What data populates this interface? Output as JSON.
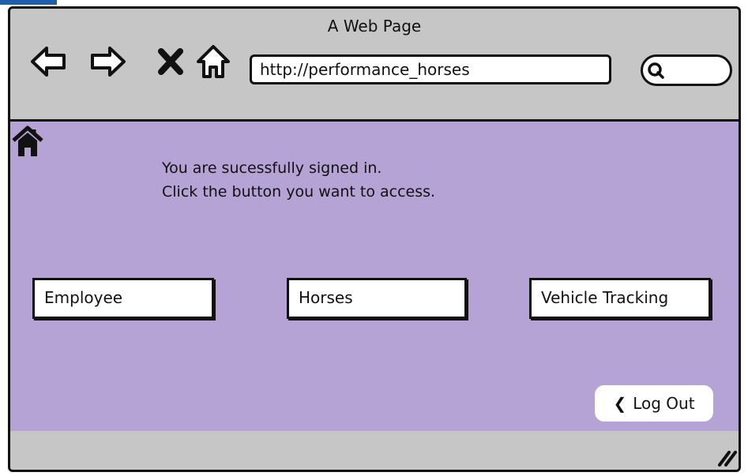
{
  "window": {
    "title": "A Web Page"
  },
  "toolbar": {
    "back_icon": "back-arrow-icon",
    "forward_icon": "forward-arrow-icon",
    "stop_icon": "close-x-icon",
    "home_icon": "home-outline-icon",
    "url": "http://performance_horses",
    "search_icon": "search-icon"
  },
  "content": {
    "background": "#b4a3d4",
    "home_marker_icon": "home-filled-icon",
    "message_line1": "You are sucessfully signed in.",
    "message_line2": "Click the button you want to access.",
    "buttons": [
      {
        "label": "Employee"
      },
      {
        "label": "Horses"
      },
      {
        "label": "Vehicle Tracking"
      }
    ],
    "logout_label": "Log Out"
  },
  "statusbar": {
    "grip_icon": "resize-grip-icon"
  }
}
